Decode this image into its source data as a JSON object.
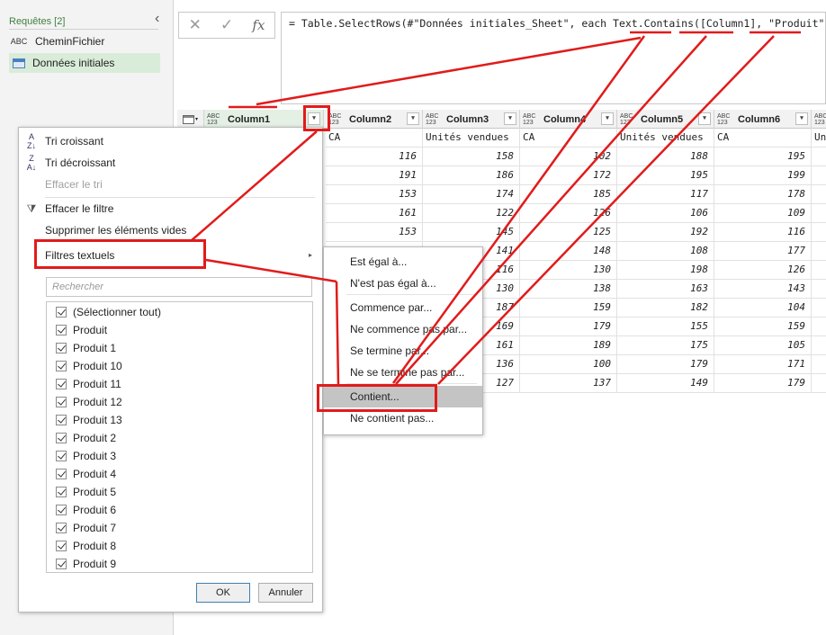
{
  "left_pane": {
    "title": "Requêtes [2]",
    "collapse_glyph": "‹",
    "queries": [
      {
        "icon": "abc-text-icon",
        "icon_glyph": "ABC",
        "label": "CheminFichier",
        "selected": false
      },
      {
        "icon": "table-icon",
        "label": "Données initiales",
        "selected": true
      }
    ]
  },
  "formula_bar": {
    "cancel_glyph": "✕",
    "confirm_glyph": "✓",
    "fx_glyph": "fx",
    "formula": "= Table.SelectRows(#\"Données initiales_Sheet\", each Text.Contains([Column1], \"Produit\"))"
  },
  "grid": {
    "type_glyph": "ABC\n123",
    "columns": [
      "Column1",
      "Column2",
      "Column3",
      "Column4",
      "Column5",
      "Column6"
    ],
    "header_row": [
      "CA",
      "Unités vendues",
      "CA",
      "Unités vendues",
      "CA"
    ],
    "last_partial_header": "Un",
    "rows": [
      [
        "116",
        "158",
        "102",
        "188",
        "195"
      ],
      [
        "191",
        "186",
        "172",
        "195",
        "199"
      ],
      [
        "153",
        "174",
        "185",
        "117",
        "178"
      ],
      [
        "161",
        "122",
        "126",
        "106",
        "109"
      ],
      [
        "153",
        "145",
        "125",
        "192",
        "116"
      ],
      [
        "",
        "141",
        "148",
        "108",
        "177"
      ],
      [
        "",
        "116",
        "130",
        "198",
        "126"
      ],
      [
        "",
        "130",
        "138",
        "163",
        "143"
      ],
      [
        "",
        "187",
        "159",
        "182",
        "104"
      ],
      [
        "",
        "169",
        "179",
        "155",
        "159"
      ],
      [
        "",
        "161",
        "189",
        "175",
        "105"
      ],
      [
        "",
        "136",
        "100",
        "179",
        "171"
      ],
      [
        "",
        "127",
        "137",
        "149",
        "179"
      ]
    ]
  },
  "filter_menu": {
    "sort_asc": "Tri croissant",
    "sort_desc": "Tri décroissant",
    "clear_sort": "Effacer le tri",
    "clear_filter": "Effacer le filtre",
    "remove_empty": "Supprimer les éléments vides",
    "text_filters": "Filtres textuels",
    "search_placeholder": "Rechercher",
    "items": [
      "(Sélectionner tout)",
      "Produit",
      "Produit 1",
      "Produit 10",
      "Produit 11",
      "Produit 12",
      "Produit 13",
      "Produit 2",
      "Produit 3",
      "Produit 4",
      "Produit 5",
      "Produit 6",
      "Produit 7",
      "Produit 8",
      "Produit 9"
    ],
    "ok": "OK",
    "cancel": "Annuler"
  },
  "text_filters_submenu": {
    "items": [
      "Est égal à...",
      "N'est pas égal à...",
      "Commence par...",
      "Ne commence pas par...",
      "Se termine par...",
      "Ne se termine pas par...",
      "Contient...",
      "Ne contient pas..."
    ],
    "highlighted": "Contient..."
  },
  "colors": {
    "annotation_red": "#e11b1b",
    "selected_query_bg": "#d9ecd9",
    "highlight_bg": "#c4c4c4"
  }
}
